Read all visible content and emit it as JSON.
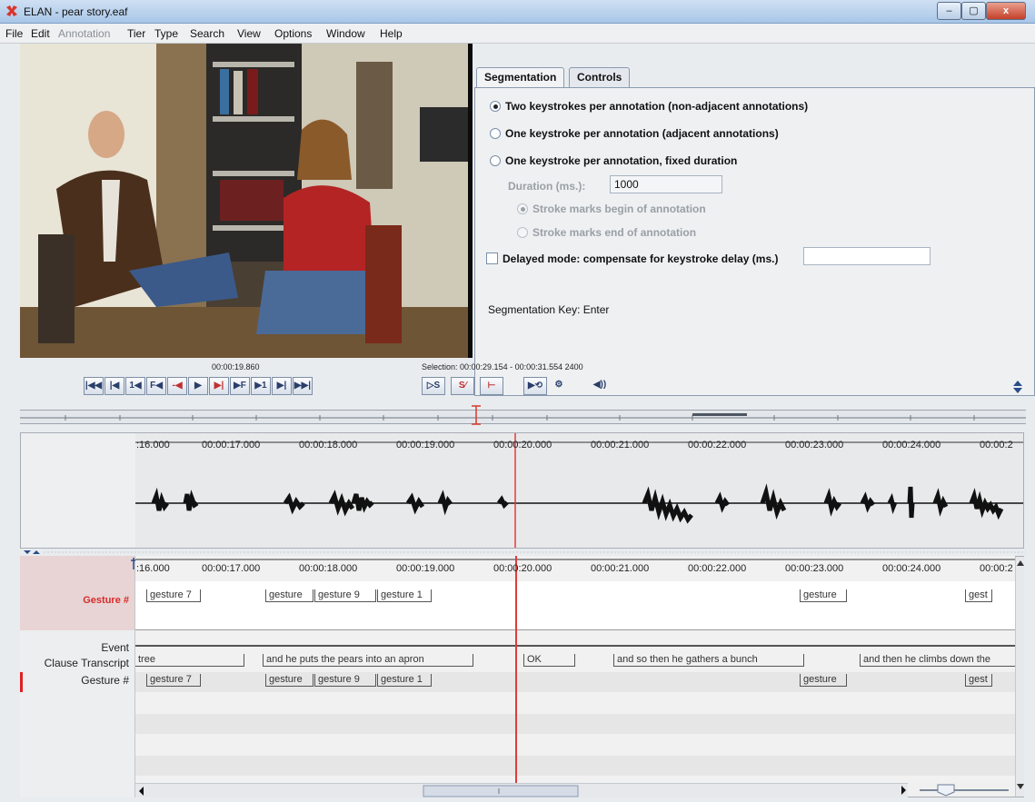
{
  "window": {
    "title": "ELAN - pear story.eaf",
    "minimize": "–",
    "maximize": "▢",
    "close": "x"
  },
  "menu": [
    "File",
    "Edit",
    "Annotation",
    "Tier",
    "Type",
    "Search",
    "View",
    "Options",
    "Window",
    "Help"
  ],
  "tabs": {
    "segmentation": "Segmentation",
    "controls": "Controls"
  },
  "segmentation": {
    "opt_two": "Two keystrokes per annotation (non-adjacent annotations)",
    "opt_one_adjacent": "One keystroke per annotation (adjacent annotations)",
    "opt_one_fixed": "One keystroke per annotation, fixed duration",
    "duration_label": "Duration (ms.):",
    "duration_value": "1000",
    "stroke_begin": "Stroke marks begin of annotation",
    "stroke_end": "Stroke marks end of annotation",
    "delayed_label": "Delayed mode: compensate for keystroke delay (ms.)",
    "delayed_value": "",
    "key_label": "Segmentation Key:  Enter"
  },
  "player": {
    "current_time": "00:00:19.860",
    "selection": "Selection: 00:00:29.154 - 00:00:31.554  2400",
    "buttons": [
      "|◀◀",
      "|◀",
      "1◀",
      "F◀",
      "-◀",
      "▶",
      "▶|",
      "▶F",
      "▶1",
      "▶|",
      "▶▶|"
    ],
    "sel_buttons": [
      "▷S",
      "S⁄",
      "⊢"
    ],
    "extra_buttons": [
      "▶⟲",
      "⚙",
      "◀))"
    ]
  },
  "timeline": {
    "ticks": [
      ":16.000",
      "00:00:17.000",
      "00:00:18.000",
      "00:00:19.000",
      "00:00:20.000",
      "00:00:21.000",
      "00:00:22.000",
      "00:00:23.000",
      "00:00:24.000",
      "00:00:2"
    ]
  },
  "tiers": {
    "names": [
      "Gesture #",
      "Event",
      "Clause Transcript",
      "Gesture #"
    ],
    "gesture_top": [
      "gesture 7",
      "gesture",
      "gesture 9",
      "gesture 1",
      "gesture",
      "gest"
    ],
    "clause": [
      "tree",
      "and he puts the pears into an apron",
      "OK",
      "and so then he gathers a bunch",
      "and then he climbs down the"
    ],
    "gesture_bottom": [
      "gesture 7",
      "gesture",
      "gesture 9",
      "gesture 1",
      "gesture",
      "gest"
    ]
  },
  "colors": {
    "accent": "#d62b2b",
    "selected_tier_bg": "#e8d4d4",
    "crosshair": "#e23b3b"
  }
}
